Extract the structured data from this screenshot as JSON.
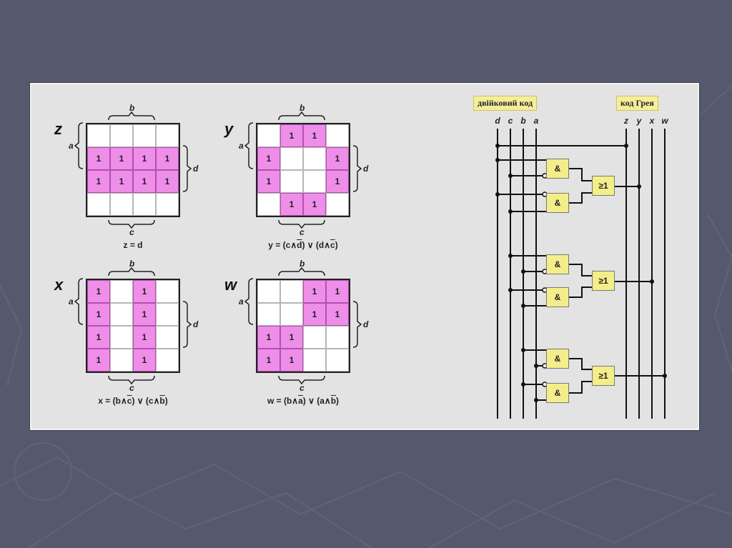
{
  "kmaps": [
    {
      "id": "z",
      "name": "z",
      "formula_html": "z = d",
      "cells": [
        [
          0,
          0,
          0,
          0
        ],
        [
          1,
          1,
          1,
          1
        ],
        [
          1,
          1,
          1,
          1
        ],
        [
          0,
          0,
          0,
          0
        ]
      ]
    },
    {
      "id": "y",
      "name": "y",
      "formula_html": "y = (c∧<span class='ov'>d</span>) ∨ (d∧<span class='ov'>c</span>)",
      "cells": [
        [
          0,
          1,
          1,
          0
        ],
        [
          1,
          0,
          0,
          1
        ],
        [
          1,
          0,
          0,
          1
        ],
        [
          0,
          1,
          1,
          0
        ]
      ]
    },
    {
      "id": "x",
      "name": "x",
      "formula_html": "x = (b∧<span class='ov'>c</span>) ∨ (c∧<span class='ov'>b</span>)",
      "cells": [
        [
          1,
          0,
          1,
          0
        ],
        [
          1,
          0,
          1,
          0
        ],
        [
          1,
          0,
          1,
          0
        ],
        [
          1,
          0,
          1,
          0
        ]
      ]
    },
    {
      "id": "w",
      "name": "w",
      "formula_html": "w = (b∧<span class='ov'>a</span>) ∨ (a∧<span class='ov'>b</span>)",
      "cells": [
        [
          0,
          0,
          1,
          1
        ],
        [
          0,
          0,
          1,
          1
        ],
        [
          1,
          1,
          0,
          0
        ],
        [
          1,
          1,
          0,
          0
        ]
      ]
    }
  ],
  "axis": {
    "a": "a",
    "b": "b",
    "c": "c",
    "d": "d"
  },
  "cell_value": "1",
  "circuit": {
    "binary_header": "двійковий код",
    "gray_header": "код Грея",
    "inputs": [
      "d",
      "c",
      "b",
      "a"
    ],
    "outputs": [
      "z",
      "y",
      "x",
      "w"
    ],
    "and_label": "&",
    "or_label": "≥1"
  }
}
